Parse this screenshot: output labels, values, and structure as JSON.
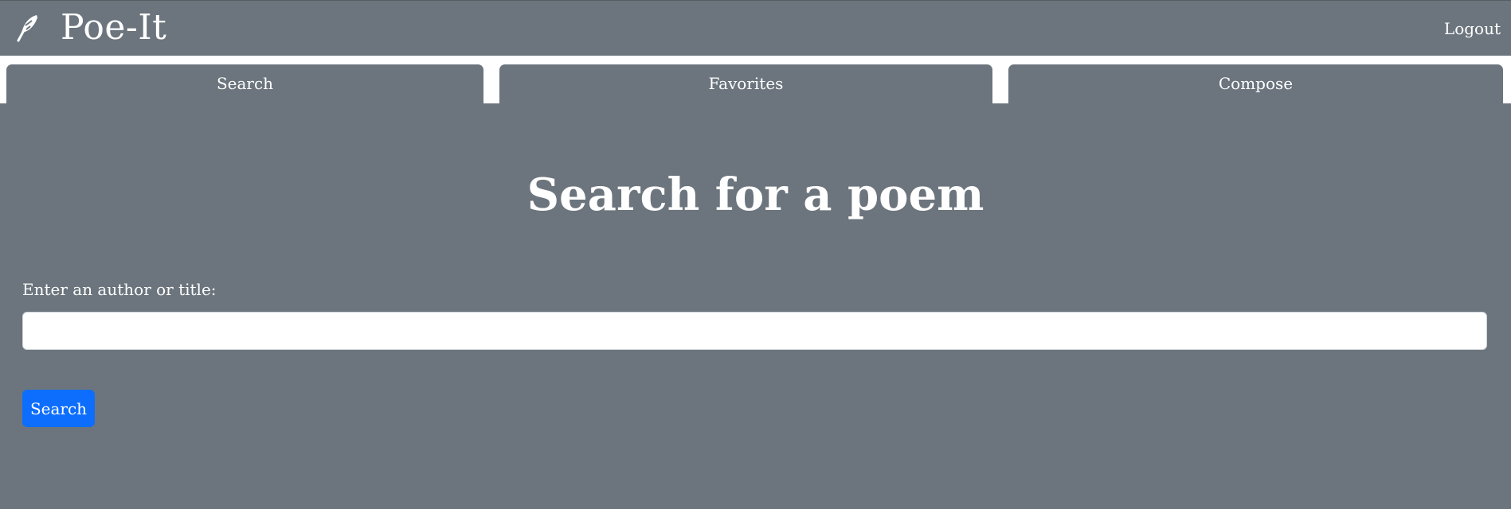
{
  "navbar": {
    "brand_name": "Poe-It",
    "brand_icon": "quill-pen-icon",
    "logout_label": "Logout"
  },
  "tabs": [
    {
      "label": "Search"
    },
    {
      "label": "Favorites"
    },
    {
      "label": "Compose"
    }
  ],
  "main": {
    "title": "Search for a poem",
    "field_label": "Enter an author or title:",
    "search_value": "",
    "search_placeholder": "",
    "search_button_label": "Search"
  },
  "colors": {
    "background_gray": "#6c757d",
    "primary_button": "#0d6efd",
    "text": "#ffffff"
  }
}
